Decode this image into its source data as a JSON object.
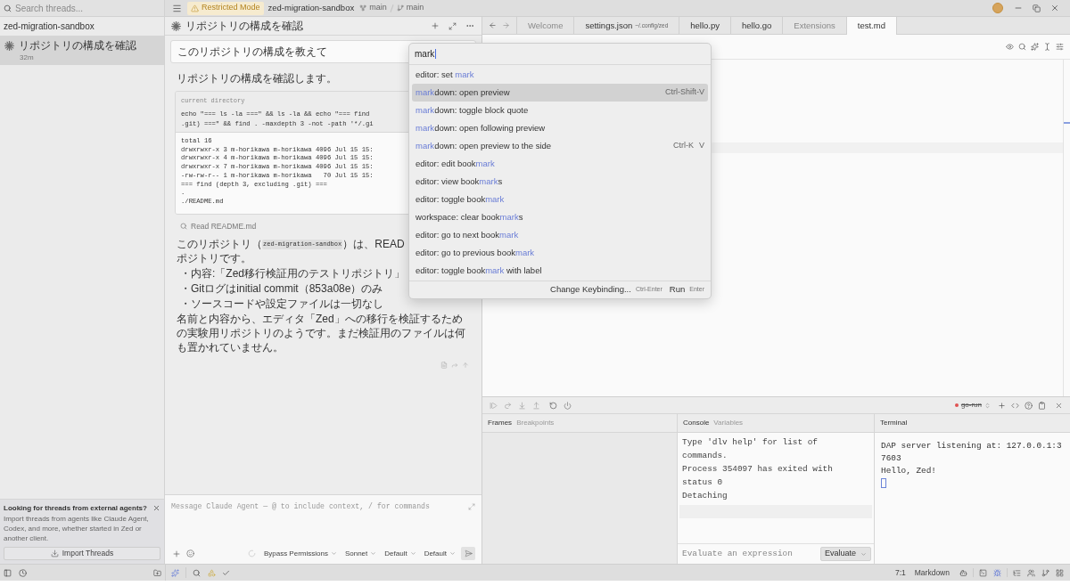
{
  "title_bar": {
    "restricted_mode": "Restricted Mode",
    "project": "zed-migration-sandbox",
    "worktree": "main",
    "branch": "main"
  },
  "sidebar": {
    "search": {
      "placeholder": "Search threads..."
    },
    "project": "zed-migration-sandbox",
    "threads": [
      {
        "title": "リポジトリの構成を確認",
        "time": "32m",
        "selected": true
      }
    ],
    "notice": {
      "title": "Looking for threads from external agents?",
      "body": "Import threads from agents like Claude Agent, Codex, and more, whether started in Zed or another client.",
      "button": "Import Threads"
    }
  },
  "agent_panel": {
    "title": "リポジトリの構成を確認",
    "user_message": "このリポジトリの構成を教えて",
    "intro": "リポジトリの構成を確認します。",
    "tool_call": {
      "label": "current directory",
      "command": [
        "echo \"=== ls -la ===\" && ls -la && echo \"=== find",
        ".git) ===\" && find . -maxdepth 3 -not -path '*/.gi"
      ],
      "output": [
        "total 16",
        "drwxrwxr-x 3 m-horikawa m-horikawa 4096 Jul 15 15:",
        "drwxrwxr-x 4 m-horikawa m-horikawa 4096 Jul 15 15:",
        "drwxrwxr-x 7 m-horikawa m-horikawa 4096 Jul 15 15:",
        "-rw-rw-r-- 1 m-horikawa m-horikawa   70 Jul 15 15:",
        "=== find (depth 3, excluding .git) ===",
        ".",
        "./README.md"
      ]
    },
    "read_step": "Read README.md",
    "answer_line_1": {
      "before": "このリポジトリ（",
      "code": "zed-migration-sandbox",
      "after": "）は、READ"
    },
    "answer_line_2": "ポジトリです。",
    "bullets": [
      "・内容:「Zed移行検証用のテストリポジトリ」",
      "・Gitログはinitial commit（853a08e）のみ",
      "・ソースコードや設定ファイルは一切なし"
    ],
    "conclusion": "名前と内容から、エディタ「Zed」への移行を検証するための実験用リポジトリのようです。まだ検証用のファイルは何も置かれていません。",
    "composer": {
      "placeholder": "Message Claude Agent — @ to include context, / for commands",
      "selectors": [
        "Bypass Permissions",
        "Sonnet",
        "Default",
        "Default"
      ]
    }
  },
  "command_palette": {
    "query": "mark",
    "items": [
      {
        "parts": [
          {
            "text": "editor: set ",
            "match": false
          },
          {
            "text": "mark",
            "match": true
          }
        ],
        "selected": false
      },
      {
        "parts": [
          {
            "text": "mark",
            "match": true
          },
          {
            "text": "down: open preview",
            "match": false
          }
        ],
        "keybinding": [
          "Ctrl-Shift-V"
        ],
        "selected": true
      },
      {
        "parts": [
          {
            "text": "mark",
            "match": true
          },
          {
            "text": "down: toggle block quote",
            "match": false
          }
        ],
        "selected": false
      },
      {
        "parts": [
          {
            "text": "mark",
            "match": true
          },
          {
            "text": "down: open following preview",
            "match": false
          }
        ],
        "selected": false
      },
      {
        "parts": [
          {
            "text": "mark",
            "match": true
          },
          {
            "text": "down: open preview to the side",
            "match": false
          }
        ],
        "keybinding": [
          "Ctrl-K",
          "V"
        ],
        "selected": false
      },
      {
        "parts": [
          {
            "text": "editor: edit book",
            "match": false
          },
          {
            "text": "mark",
            "match": true
          }
        ],
        "selected": false
      },
      {
        "parts": [
          {
            "text": "editor: view book",
            "match": false
          },
          {
            "text": "mark",
            "match": true
          },
          {
            "text": "s",
            "match": false
          }
        ],
        "selected": false
      },
      {
        "parts": [
          {
            "text": "editor: toggle book",
            "match": false
          },
          {
            "text": "mark",
            "match": true
          }
        ],
        "selected": false
      },
      {
        "parts": [
          {
            "text": "workspace: clear book",
            "match": false
          },
          {
            "text": "mark",
            "match": true
          },
          {
            "text": "s",
            "match": false
          }
        ],
        "selected": false
      },
      {
        "parts": [
          {
            "text": "editor: go to next book",
            "match": false
          },
          {
            "text": "mark",
            "match": true
          }
        ],
        "selected": false
      },
      {
        "parts": [
          {
            "text": "editor: go to previous book",
            "match": false
          },
          {
            "text": "mark",
            "match": true
          }
        ],
        "selected": false
      },
      {
        "parts": [
          {
            "text": "editor: toggle book",
            "match": false
          },
          {
            "text": "mark",
            "match": true
          },
          {
            "text": " with label",
            "match": false
          }
        ],
        "selected": false
      }
    ],
    "footer": {
      "change_keybinding": "Change Keybinding...",
      "change_keybinding_key": "Ctrl-Enter",
      "run": "Run",
      "run_key": "Enter"
    }
  },
  "editor": {
    "tabs": [
      {
        "label": "Welcome",
        "kind": "page",
        "selected": false
      },
      {
        "label": "settings.json",
        "detail": "~/.config/zed",
        "kind": "file",
        "selected": false
      },
      {
        "label": "hello.py",
        "kind": "file",
        "selected": false
      },
      {
        "label": "hello.go",
        "kind": "file",
        "selected": false
      },
      {
        "label": "Extensions",
        "kind": "page",
        "selected": false
      },
      {
        "label": "test.md",
        "kind": "file",
        "selected": true
      }
    ]
  },
  "debugger": {
    "session": {
      "label": "go-run",
      "ended": true
    },
    "panes": [
      {
        "kind": "frames",
        "tabs": [
          {
            "label": "Frames",
            "selected": true
          },
          {
            "label": "Breakpoints",
            "selected": false
          }
        ]
      },
      {
        "kind": "console",
        "tabs": [
          {
            "label": "Console",
            "selected": true
          },
          {
            "label": "Variables",
            "selected": false
          }
        ],
        "lines": [
          "Type 'dlv help' for list of commands.",
          "Process 354097 has exited with status 0",
          "Detaching"
        ],
        "input": {
          "placeholder": "Evaluate an expression"
        },
        "button": "Evaluate"
      },
      {
        "kind": "terminal",
        "tabs": [
          {
            "label": "Terminal",
            "selected": true
          }
        ],
        "lines": [
          "DAP server listening at: 127.0.0.1:37603",
          "Hello, Zed!"
        ]
      }
    ]
  },
  "status_bar": {
    "position": "7:1",
    "language": "Markdown"
  }
}
